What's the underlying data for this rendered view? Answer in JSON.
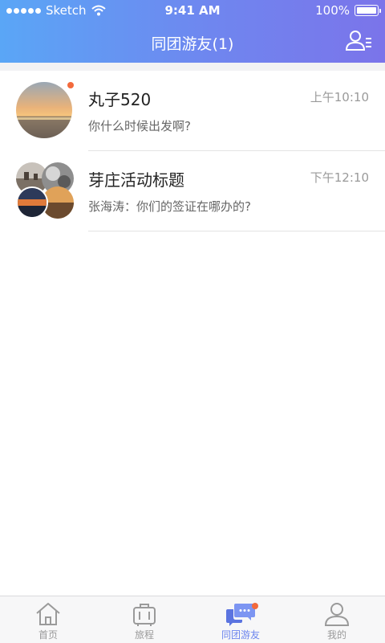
{
  "status_bar": {
    "carrier": "Sketch",
    "time": "9:41 AM",
    "battery": "100%"
  },
  "header": {
    "title": "同团游友(1)",
    "contacts_icon": "contacts-icon"
  },
  "chats": [
    {
      "name": "丸子520",
      "time": "上午10:10",
      "preview": "你什么时候出发啊?",
      "unread": true
    },
    {
      "name": "芽庄活动标题",
      "time": "下午12:10",
      "preview": "张海涛：你们的签证在哪办的?",
      "unread": false
    }
  ],
  "tabs": [
    {
      "label": "首页",
      "icon": "home-icon",
      "active": false
    },
    {
      "label": "旅程",
      "icon": "luggage-icon",
      "active": false
    },
    {
      "label": "同团游友",
      "icon": "chat-bubbles-icon",
      "active": true,
      "badge": true
    },
    {
      "label": "我的",
      "icon": "profile-icon",
      "active": false
    }
  ],
  "colors": {
    "accent": "#6d86ee",
    "badge": "#f36a3c",
    "header_start": "#5aa6f6",
    "header_end": "#7b74ea"
  }
}
